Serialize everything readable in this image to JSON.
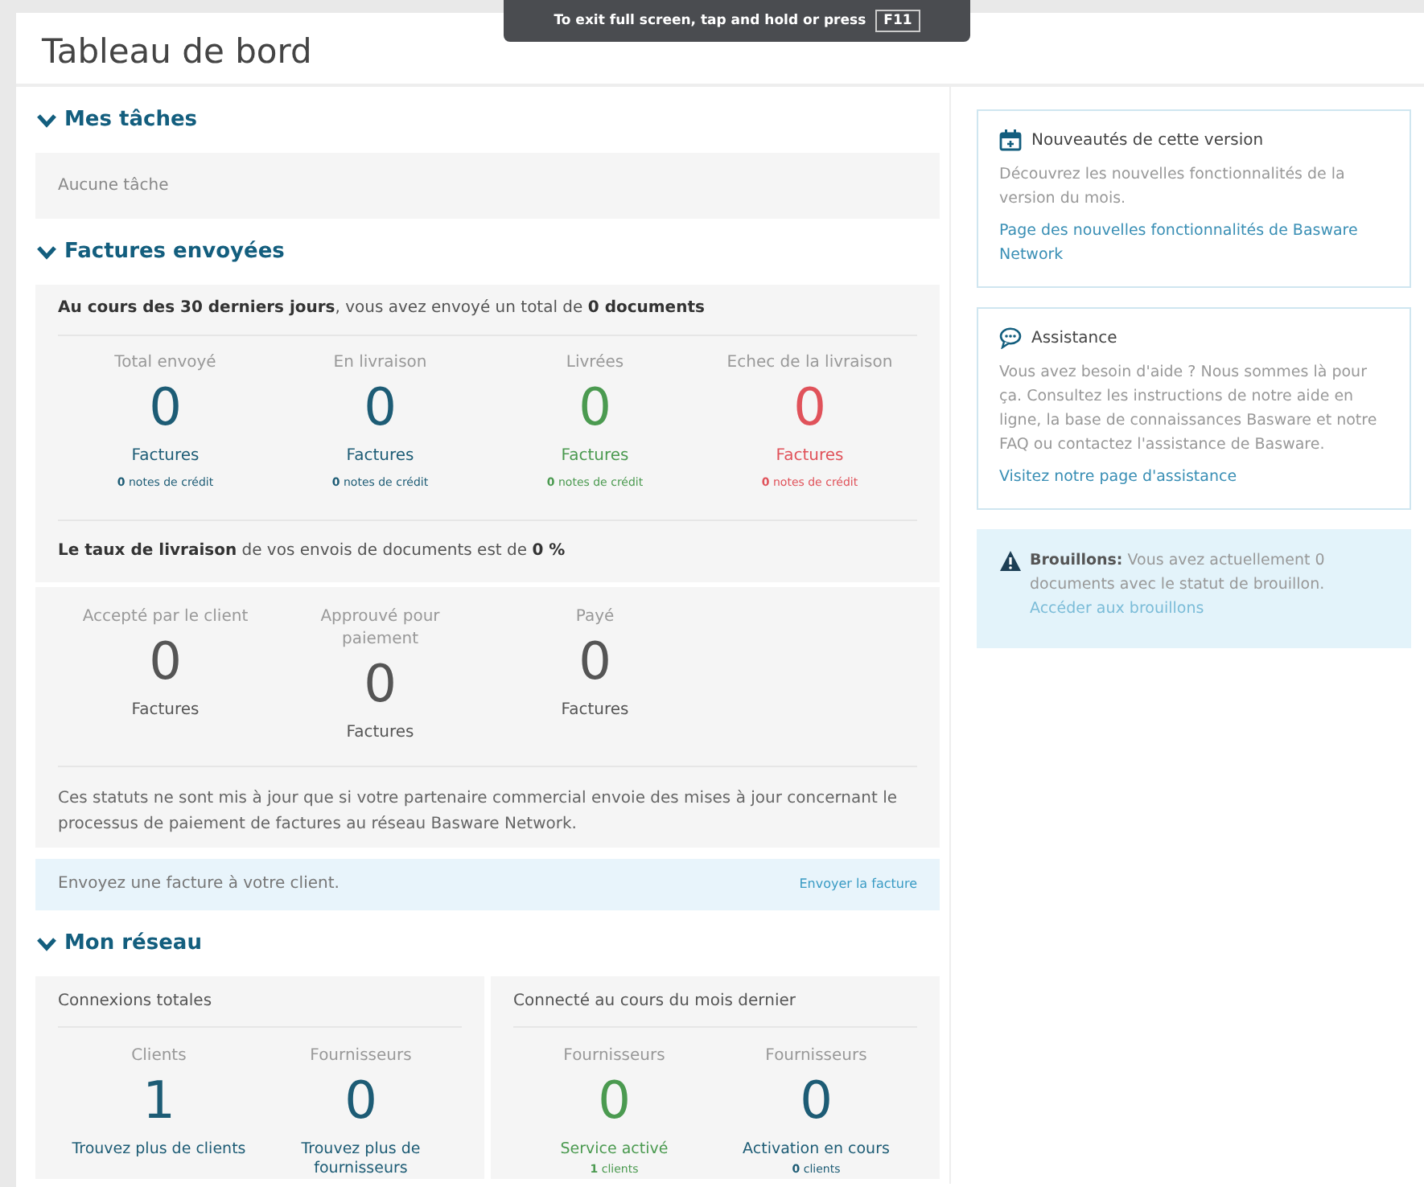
{
  "toast": {
    "text": "To exit full screen, tap and hold or press",
    "key": "F11"
  },
  "title": "Tableau de bord",
  "tasks": {
    "heading": "Mes tâches",
    "expanded": true,
    "empty_text": "Aucune tâche"
  },
  "sent": {
    "heading": "Factures envoyées",
    "expanded": true,
    "summary": "**Au cours des 30 derniers jours**, vous avez envoyé un total de **0 documents**",
    "stats": [
      {
        "label": "Total envoyé",
        "value": "0",
        "unit": "Factures",
        "credit": "**0** notes de crédit",
        "color": "#1d5c75"
      },
      {
        "label": "En livraison",
        "value": "0",
        "unit": "Factures",
        "credit": "**0** notes de crédit",
        "color": "#1d5c75"
      },
      {
        "label": "Livrées",
        "value": "0",
        "unit": "Factures",
        "credit": "**0** notes de crédit",
        "color": "#4b9a50"
      },
      {
        "label": "Echec de la livraison",
        "value": "0",
        "unit": "Factures",
        "credit": "**0** notes de crédit",
        "color": "#e0525a"
      }
    ],
    "rate": "**Le taux de livraison** de vos envois de documents est de **0 %**",
    "statuses": [
      {
        "label": "Accepté par le client",
        "value": "0",
        "unit": "Factures"
      },
      {
        "label": "Approuvé pour paiement",
        "value": "0",
        "unit": "Factures"
      },
      {
        "label": "Payé",
        "value": "0",
        "unit": "Factures"
      }
    ],
    "note": "Ces statuts ne sont mis à jour que si votre partenaire commercial envoie des mises à jour concernant le processus de paiement de factures au réseau Basware Network.",
    "cta": {
      "text": "Envoyez une facture à votre client.",
      "link": "Envoyer la facture"
    }
  },
  "network": {
    "heading": "Mon réseau",
    "expanded": true,
    "panels": [
      {
        "title": "Connexions totales",
        "stats": [
          {
            "label": "Clients",
            "value": "1",
            "link": "Trouvez plus de clients",
            "color": "#1d5c75"
          },
          {
            "label": "Fournisseurs",
            "value": "0",
            "link": "Trouvez plus de fournisseurs",
            "color": "#1d5c75"
          }
        ]
      },
      {
        "title": "Connecté au cours du mois dernier",
        "stats": [
          {
            "label": "Fournisseurs",
            "value": "0",
            "link": "Service activé",
            "color": "#4b9a50",
            "clients": "**1** clients"
          },
          {
            "label": "Fournisseurs",
            "value": "0",
            "link": "Activation en cours",
            "color": "#1d5c75",
            "clients": "**0** clients"
          }
        ]
      }
    ]
  },
  "sidebar": [
    {
      "kind": "whats-new",
      "title": "Nouveautés de cette version",
      "text": "Découvrez les nouvelles fonctionnalités de la version du mois.",
      "link": "Page des nouvelles fonctionnalités de Basware Network"
    },
    {
      "kind": "support",
      "title": "Assistance",
      "text": "Vous avez besoin d'aide ? Nous sommes là pour ça. Consultez les instructions de notre aide en ligne, la base de connaissances Basware et notre FAQ ou contactez l'assistance de Basware.",
      "link": "Visitez notre page d'assistance"
    },
    {
      "kind": "drafts",
      "title": "Brouillons:",
      "text": "Vous avez actuellement 0 documents avec le statut de brouillon.",
      "link": "Accéder aux brouillons"
    }
  ]
}
